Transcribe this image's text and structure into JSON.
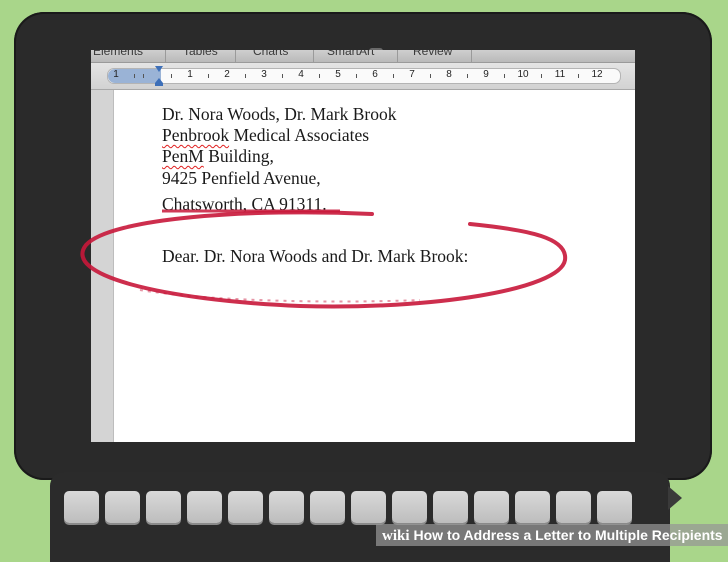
{
  "ribbon": {
    "tabs": [
      "Elements",
      "Tables",
      "Charts",
      "SmartArt",
      "Review"
    ]
  },
  "ruler": {
    "labels": [
      "1",
      "1",
      "2",
      "3",
      "4",
      "5",
      "6",
      "7",
      "8",
      "9",
      "10",
      "11",
      "12"
    ]
  },
  "document": {
    "line1": "Dr. Nora Woods, Dr. Mark Brook",
    "line2_word1": "Penbrook",
    "line2_rest": " Medical Associates",
    "line3_word1": "PenM",
    "line3_rest": " Building,",
    "line4": "9425 Penfield Avenue,",
    "line5": "Chatsworth, CA 91311.",
    "salutation": "Dear. Dr. Nora Woods and Dr. Mark Brook:"
  },
  "annotation": {
    "color": "#c8173a"
  },
  "banner": {
    "brand": "wiki",
    "title": "How to Address a Letter to Multiple Recipients"
  }
}
